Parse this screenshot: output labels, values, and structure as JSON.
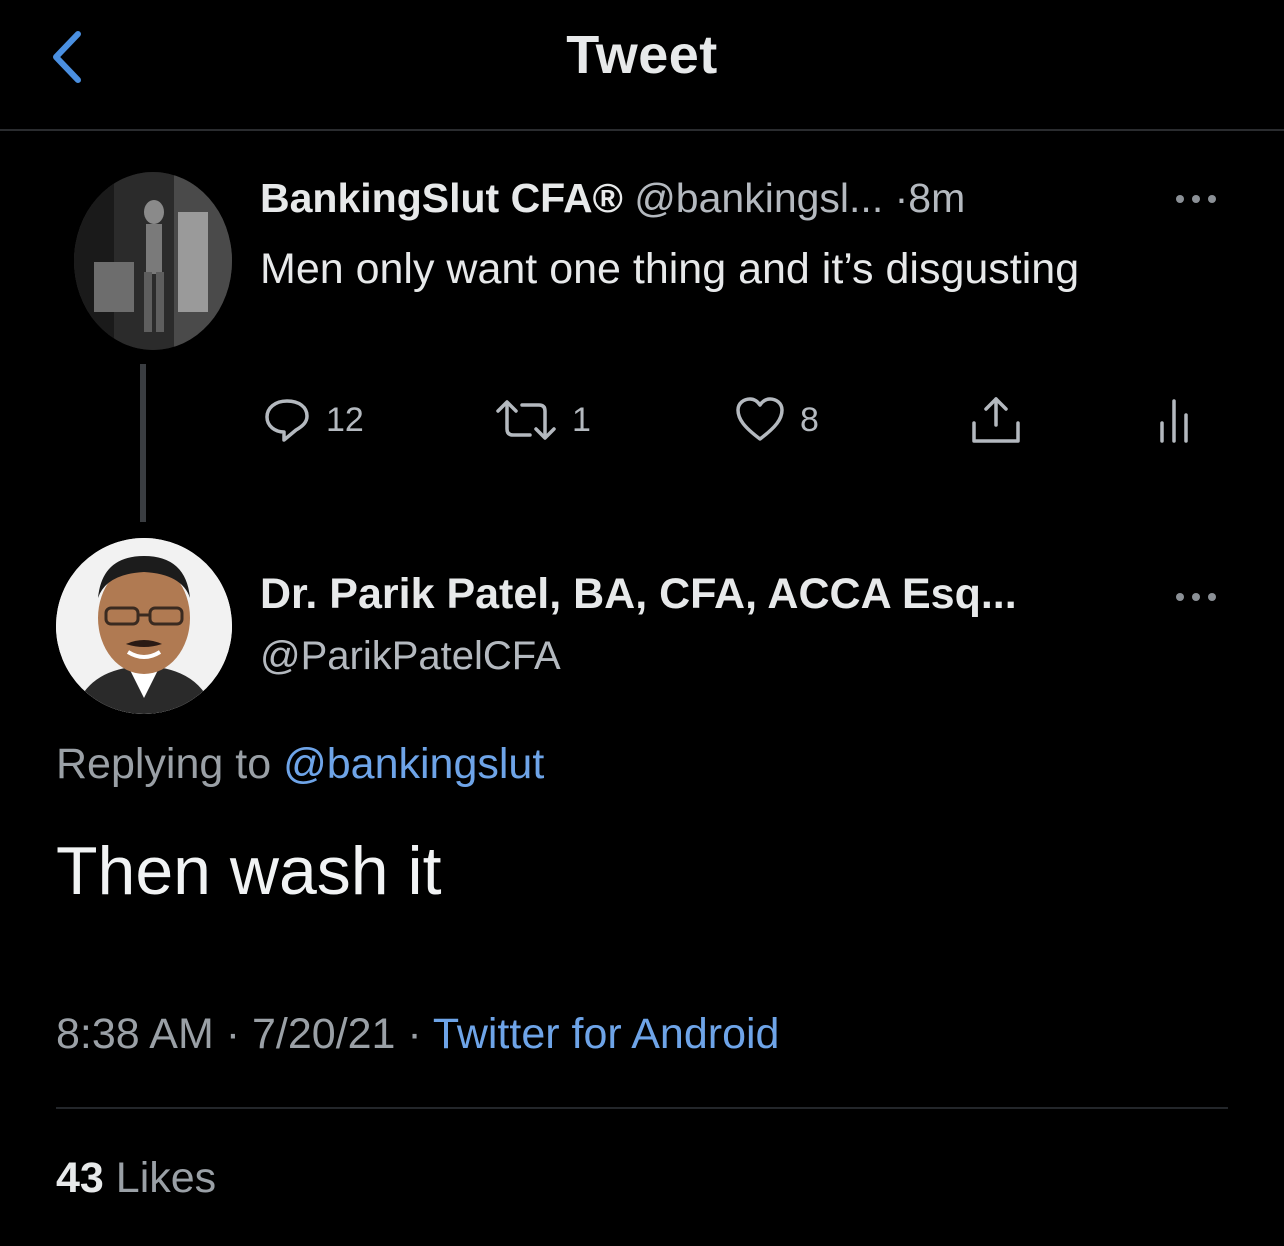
{
  "header": {
    "title": "Tweet",
    "back_icon": "chevron-left-icon",
    "accent_color": "#4a8fe0"
  },
  "parent_tweet": {
    "display_name": "BankingSlut CFA®",
    "handle": "@bankingsl...",
    "separator": "·",
    "time": "8m",
    "text": "Men only want one thing and it’s disgusting",
    "actions": {
      "replies": "12",
      "retweets": "1",
      "likes": "8"
    }
  },
  "reply_tweet": {
    "display_name": "Dr. Parik Patel, BA, CFA, ACCA Esq...",
    "handle": "@ParikPatelCFA",
    "replying_to_prefix": "Replying to",
    "replying_to_handle": "@bankingslut",
    "text": "Then wash it",
    "time": "8:38 AM",
    "date": "7/20/21",
    "separator": "·",
    "source": "Twitter for Android",
    "link_color": "#6ea4e8"
  },
  "stats": {
    "likes_count": "43",
    "likes_label": "Likes"
  }
}
